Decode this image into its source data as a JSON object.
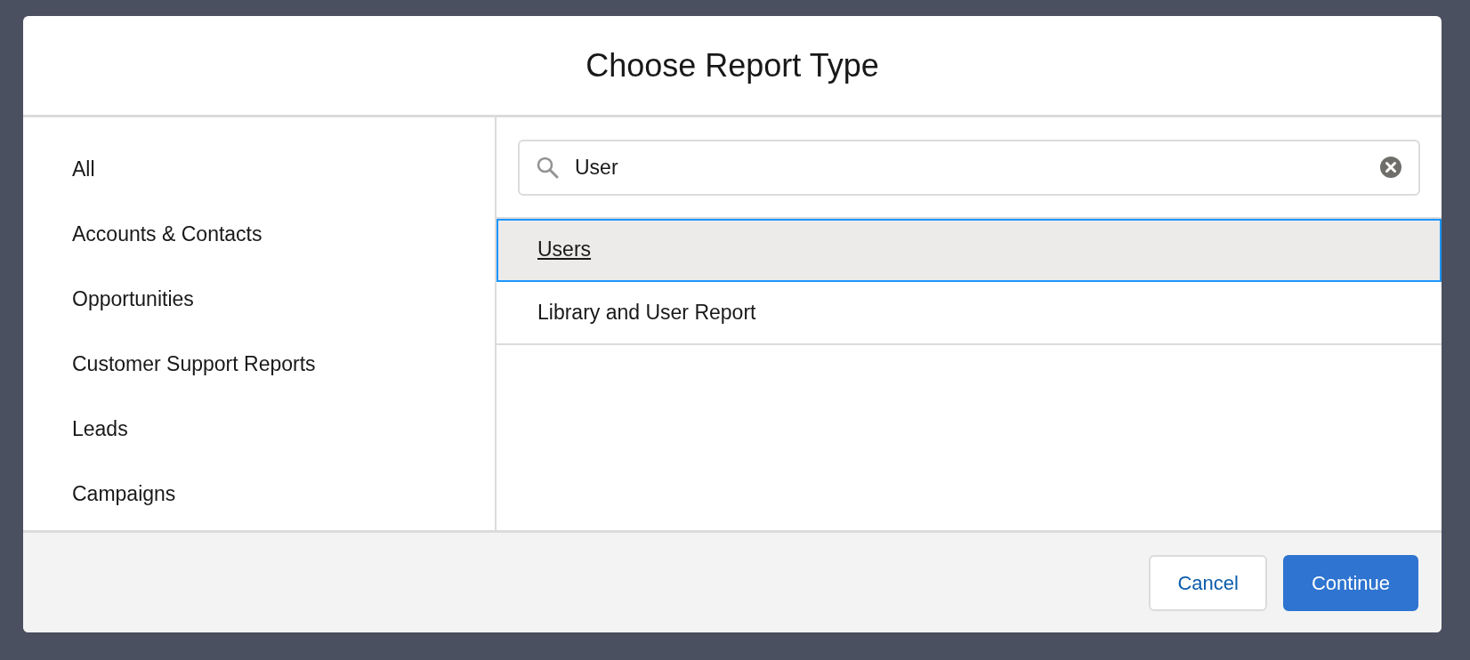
{
  "dialog": {
    "title": "Choose Report Type"
  },
  "sidebar": {
    "items": [
      {
        "label": "All"
      },
      {
        "label": "Accounts & Contacts"
      },
      {
        "label": "Opportunities"
      },
      {
        "label": "Customer Support Reports"
      },
      {
        "label": "Leads"
      },
      {
        "label": "Campaigns"
      }
    ]
  },
  "search": {
    "value": "User"
  },
  "results": [
    {
      "label": "Users",
      "selected": true
    },
    {
      "label": "Library and User Report",
      "selected": false
    }
  ],
  "buttons": [
    {
      "label": "Cancel",
      "kind": "neutral"
    },
    {
      "label": "Continue",
      "kind": "brand"
    }
  ]
}
